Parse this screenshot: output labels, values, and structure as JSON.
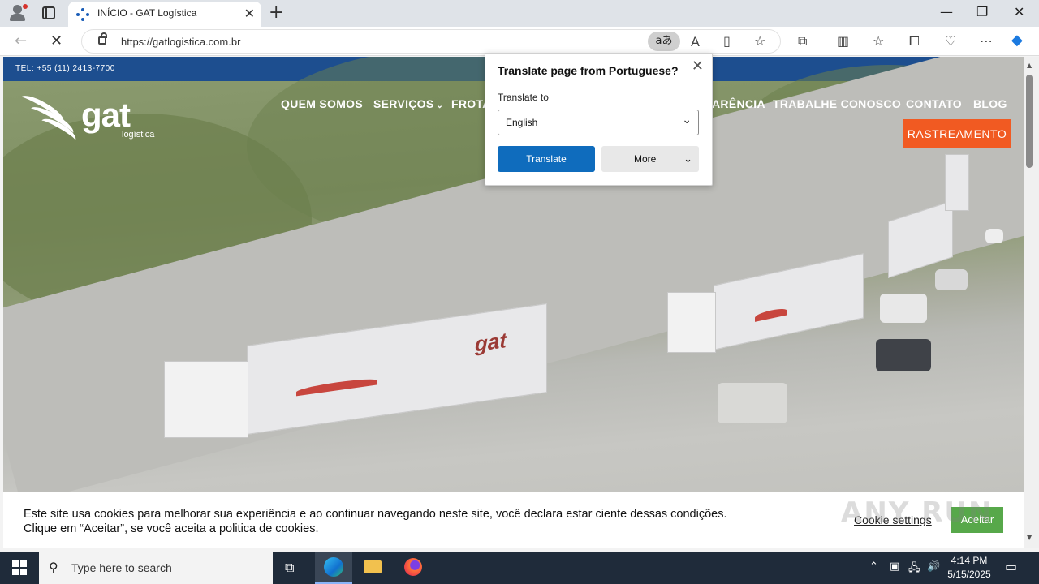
{
  "browser": {
    "tab_title": "INÍCIO - GAT Logística",
    "url": "https://gatlogistica.com.br",
    "translate_pill": "aあ",
    "win_min": "—",
    "win_restore": "❐",
    "win_close": "✕",
    "tab_close": "✕",
    "new_tab": "+"
  },
  "site": {
    "phone": "TEL: +55 (11) 2413-7700",
    "logo_word": "gat",
    "logo_sub": "logística",
    "nav": {
      "quem_somos": "QUEM SOMOS",
      "servicos": "SERVIÇOS",
      "frota": "FROTA",
      "transparencia": "ARÊNCIA",
      "trabalhe": "TRABALHE CONOSCO",
      "contato": "CONTATO",
      "blog": "BLOG"
    },
    "cta": "RASTREAMENTO",
    "truck_label": "gat"
  },
  "translate_popup": {
    "title": "Translate page from Portuguese?",
    "label": "Translate to",
    "selected_language": "English",
    "translate_btn": "Translate",
    "more_btn": "More"
  },
  "cookie": {
    "text": "Este site usa cookies para melhorar sua experiência e ao continuar navegando neste site, você declara estar ciente dessas condições. Clique em “Aceitar”, se você aceita a politica de cookies.",
    "settings": "Cookie settings",
    "accept": "Aceitar"
  },
  "watermark": "ANY RUN",
  "taskbar": {
    "search_placeholder": "Type here to search",
    "time": "4:14 PM",
    "date": "5/15/2025"
  },
  "colors": {
    "brand_blue": "#1d4e8f",
    "brand_orange": "#f15a22",
    "accept_green": "#57a84a",
    "edge_blue": "#0f6cbd"
  }
}
